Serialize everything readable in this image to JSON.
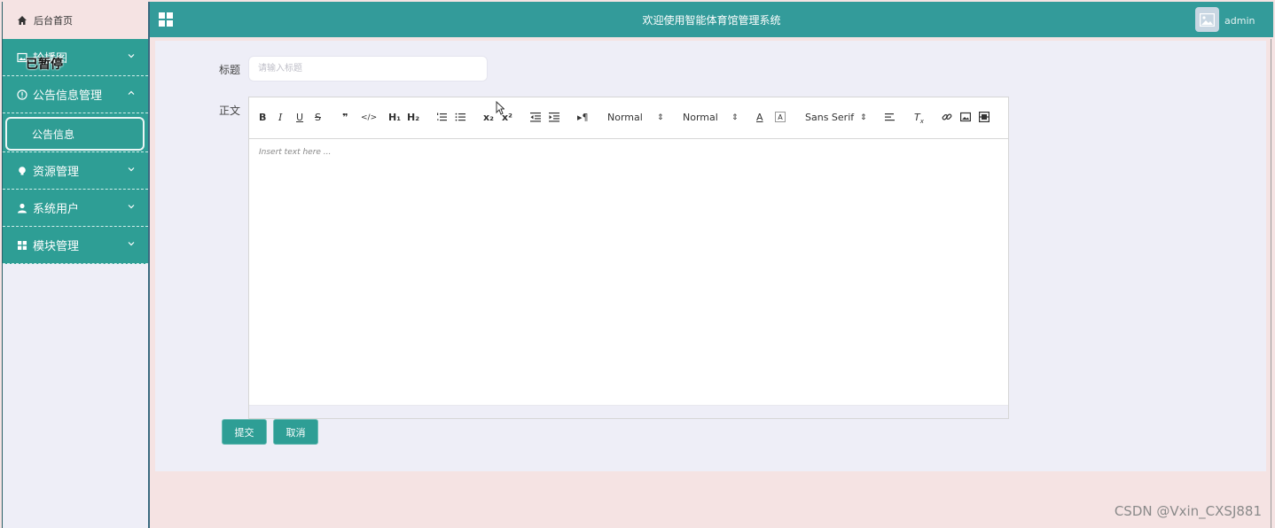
{
  "sidebar": {
    "home": "后台首页",
    "items": [
      {
        "label": "轮播图",
        "icon": "image-icon",
        "expanded": false
      },
      {
        "label": "公告信息管理",
        "icon": "info-circle-icon",
        "expanded": true
      },
      {
        "label": "资源管理",
        "icon": "bulb-icon",
        "expanded": false
      },
      {
        "label": "系统用户",
        "icon": "user-icon",
        "expanded": false
      },
      {
        "label": "模块管理",
        "icon": "grid-icon",
        "expanded": false
      }
    ],
    "subitem": "公告信息"
  },
  "overlay": {
    "paused": "已暂停"
  },
  "header": {
    "title": "欢迎使用智能体育馆管理系统",
    "user": "admin"
  },
  "form": {
    "title_label": "标题",
    "title_placeholder": "请输入标题",
    "body_label": "正文",
    "editor_placeholder": "Insert text here ...",
    "toolbar": {
      "header_select": "Normal",
      "size_select": "Normal",
      "font_select": "Sans Serif"
    },
    "submit": "提交",
    "cancel": "取消"
  },
  "watermark": "CSDN @Vxin_CXSJ881",
  "colors": {
    "accent": "#2e9e95",
    "header": "#339b9a",
    "panel": "#eeeef7",
    "page": "#f5e3e3"
  }
}
